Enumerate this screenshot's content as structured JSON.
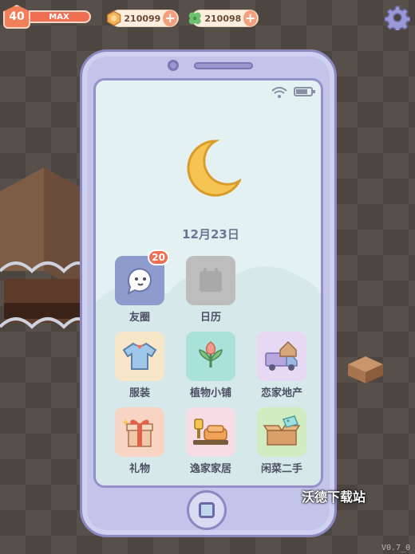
{
  "hud": {
    "level": "40",
    "xp_label": "MAX",
    "coins": "210099",
    "clovers": "210098"
  },
  "phone": {
    "date": "12月23日",
    "battery_level": 0.8,
    "apps": [
      {
        "id": "friends",
        "label": "友圈",
        "icon": "ghost-chat-icon",
        "badge": "20",
        "bg": "#8e9ccd"
      },
      {
        "id": "calendar",
        "label": "日历",
        "icon": "calendar-icon",
        "bg": "#bdbdbd"
      },
      {
        "id": "clothes",
        "label": "服装",
        "icon": "shirt-icon",
        "bg": "#f8e6c9"
      },
      {
        "id": "plants",
        "label": "植物小铺",
        "icon": "plant-icon",
        "bg": "#a9e2d8"
      },
      {
        "id": "realestate",
        "label": "恋家地产",
        "icon": "moving-truck-icon",
        "bg": "#e7d9f3"
      },
      {
        "id": "gifts",
        "label": "礼物",
        "icon": "gift-icon",
        "bg": "#f7d4c3"
      },
      {
        "id": "furniture",
        "label": "逸家家居",
        "icon": "sofa-icon",
        "bg": "#f6dce5"
      },
      {
        "id": "secondhand",
        "label": "闲菜二手",
        "icon": "box-icon",
        "bg": "#d2ecc2"
      }
    ]
  },
  "watermark": "沃德下载站",
  "version": "V0.7_0"
}
